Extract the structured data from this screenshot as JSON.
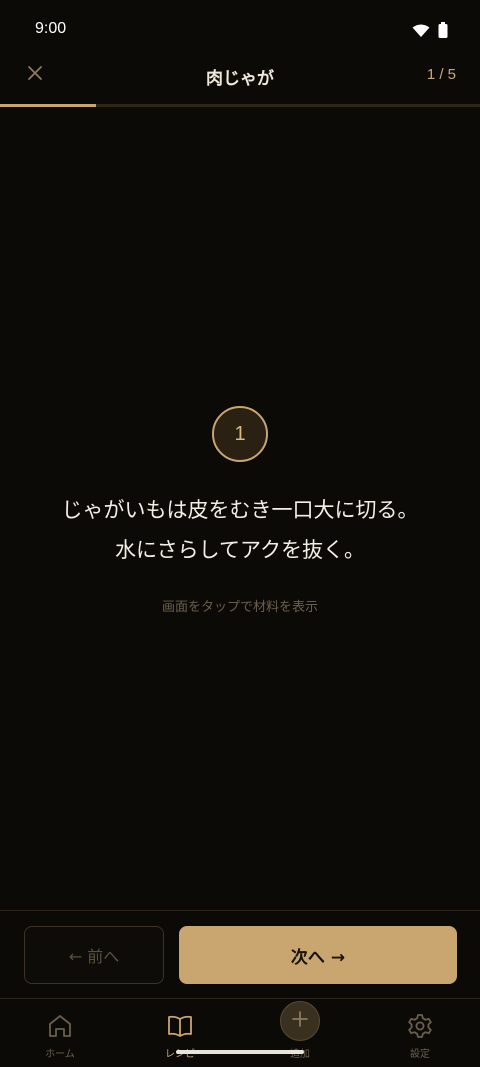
{
  "status_bar": {
    "time": "9:00",
    "icons": [
      "wifi-icon",
      "battery-icon"
    ]
  },
  "header": {
    "close_icon": "close-icon",
    "title": "肉じゃが",
    "step_counter": "1 / 5"
  },
  "progress": {
    "current_step": 1,
    "total_steps": 5,
    "fraction": 0.2
  },
  "step": {
    "number": "1",
    "instruction_lines": [
      "じゃがいもは皮をむき一口大に切る。",
      "水にさらしてアクを抜く。"
    ],
    "hint": "画面をタップで材料を表示"
  },
  "navigation": {
    "prev_label": "← 前へ",
    "next_label": "次へ →"
  },
  "bottom_nav": {
    "items": [
      {
        "label": "ホーム",
        "icon": "home-icon",
        "active": false
      },
      {
        "label": "レシピ",
        "icon": "book-icon",
        "active": true
      },
      {
        "label": "追加",
        "icon": "plus-icon",
        "active": false
      },
      {
        "label": "設定",
        "icon": "gear-icon",
        "active": false
      }
    ]
  },
  "colors": {
    "background": "#0c0a07",
    "accent": "#c9a570",
    "text_primary": "#f3efe6",
    "text_muted": "#6b5f4c"
  }
}
